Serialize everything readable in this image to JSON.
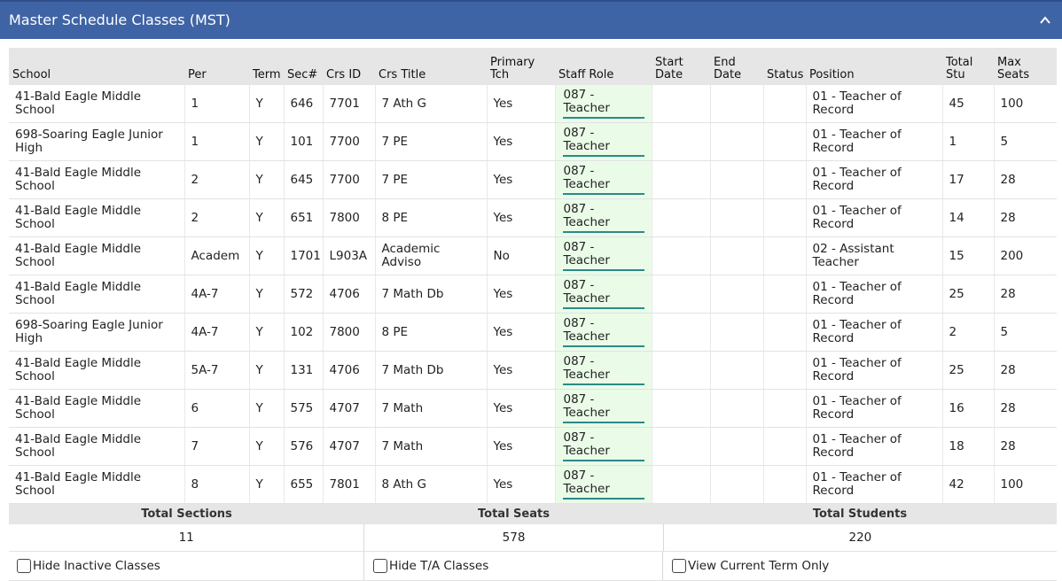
{
  "panel": {
    "title": "Master Schedule Classes (MST)"
  },
  "columns": [
    "School",
    "Per",
    "Term",
    "Sec#",
    "Crs ID",
    "Crs Title",
    "Primary Tch",
    "Staff Role",
    "Start Date",
    "End Date",
    "Status",
    "Position",
    "Total Stu",
    "Max Seats"
  ],
  "rows": [
    [
      "41-Bald Eagle Middle School",
      "1",
      "Y",
      "646",
      "7701",
      "7 Ath G",
      "Yes",
      "087 - Teacher",
      "",
      "",
      "",
      "01 - Teacher of Record",
      "45",
      "100"
    ],
    [
      "698-Soaring Eagle Junior High",
      "1",
      "Y",
      "101",
      "7700",
      "7 PE",
      "Yes",
      "087 - Teacher",
      "",
      "",
      "",
      "01 - Teacher of Record",
      "1",
      "5"
    ],
    [
      "41-Bald Eagle Middle School",
      "2",
      "Y",
      "645",
      "7700",
      "7 PE",
      "Yes",
      "087 - Teacher",
      "",
      "",
      "",
      "01 - Teacher of Record",
      "17",
      "28"
    ],
    [
      "41-Bald Eagle Middle School",
      "2",
      "Y",
      "651",
      "7800",
      "8 PE",
      "Yes",
      "087 - Teacher",
      "",
      "",
      "",
      "01 - Teacher of Record",
      "14",
      "28"
    ],
    [
      "41-Bald Eagle Middle School",
      "Academ",
      "Y",
      "1701",
      "L903A",
      "Academic Adviso",
      "No",
      "087 - Teacher",
      "",
      "",
      "",
      "02 - Assistant Teacher",
      "15",
      "200"
    ],
    [
      "41-Bald Eagle Middle School",
      "4A-7",
      "Y",
      "572",
      "4706",
      "7 Math Db",
      "Yes",
      "087 - Teacher",
      "",
      "",
      "",
      "01 - Teacher of Record",
      "25",
      "28"
    ],
    [
      "698-Soaring Eagle Junior High",
      "4A-7",
      "Y",
      "102",
      "7800",
      "8 PE",
      "Yes",
      "087 - Teacher",
      "",
      "",
      "",
      "01 - Teacher of Record",
      "2",
      "5"
    ],
    [
      "41-Bald Eagle Middle School",
      "5A-7",
      "Y",
      "131",
      "4706",
      "7 Math Db",
      "Yes",
      "087 - Teacher",
      "",
      "",
      "",
      "01 - Teacher of Record",
      "25",
      "28"
    ],
    [
      "41-Bald Eagle Middle School",
      "6",
      "Y",
      "575",
      "4707",
      "7 Math",
      "Yes",
      "087 - Teacher",
      "",
      "",
      "",
      "01 - Teacher of Record",
      "16",
      "28"
    ],
    [
      "41-Bald Eagle Middle School",
      "7",
      "Y",
      "576",
      "4707",
      "7 Math",
      "Yes",
      "087 - Teacher",
      "",
      "",
      "",
      "01 - Teacher of Record",
      "18",
      "28"
    ],
    [
      "41-Bald Eagle Middle School",
      "8",
      "Y",
      "655",
      "7801",
      "8 Ath G",
      "Yes",
      "087 - Teacher",
      "",
      "",
      "",
      "01 - Teacher of Record",
      "42",
      "100"
    ]
  ],
  "link_sections": [
    "101",
    "102"
  ],
  "totals": {
    "sections_label": "Total Sections",
    "sections_value": "11",
    "seats_label": "Total Seats",
    "seats_value": "578",
    "students_label": "Total Students",
    "students_value": "220"
  },
  "options": {
    "hide_inactive": "Hide Inactive Classes",
    "hide_ta": "Hide T/A Classes",
    "current_term": "View Current Term Only"
  },
  "icons": {
    "collapse": "chevron-up-icon"
  },
  "colors": {
    "header_bar": "#3f64a5",
    "staff_role_bg": "#eafce8",
    "link": "#2d5b9e"
  }
}
